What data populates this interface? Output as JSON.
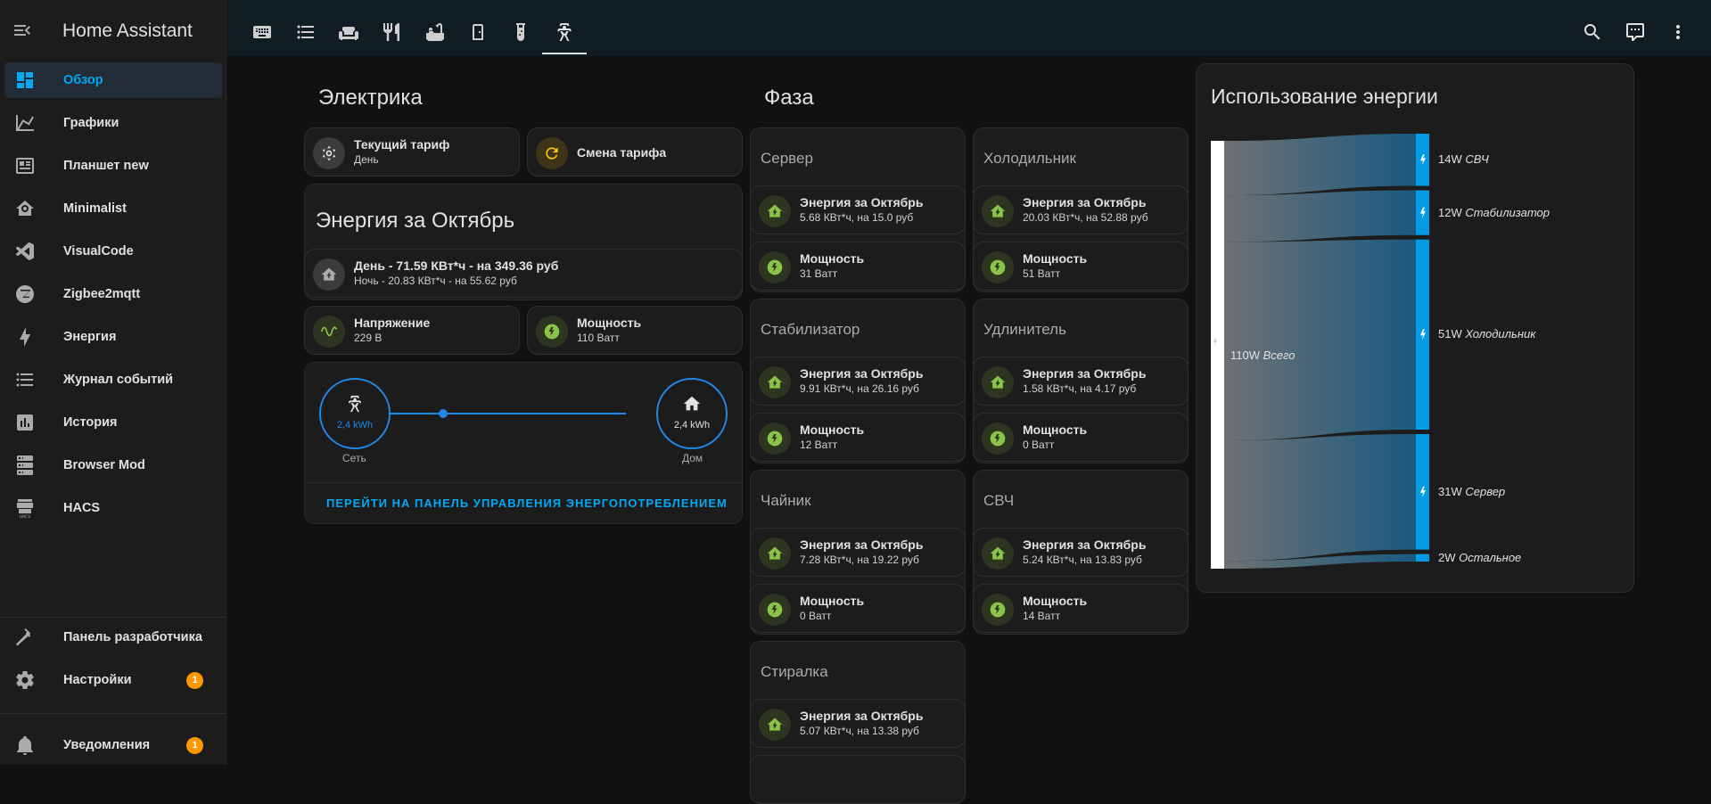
{
  "app": {
    "title": "Home Assistant"
  },
  "sidebar": {
    "items": [
      {
        "label": "Обзор"
      },
      {
        "label": "Графики"
      },
      {
        "label": "Планшет new"
      },
      {
        "label": "Minimalist"
      },
      {
        "label": "VisualCode"
      },
      {
        "label": "Zigbee2mqtt"
      },
      {
        "label": "Энергия"
      },
      {
        "label": "Журнал событий"
      },
      {
        "label": "История"
      },
      {
        "label": "Browser Mod"
      },
      {
        "label": "HACS"
      }
    ],
    "developer": {
      "label": "Панель разработчика"
    },
    "settings": {
      "label": "Настройки",
      "badge": "1"
    },
    "notifications": {
      "label": "Уведомления",
      "badge": "1"
    }
  },
  "colors": {
    "accent": "#03a9f4",
    "badge": "#ff9800",
    "green": "#8bc34a",
    "flow": "#1e88e5"
  },
  "electrics": {
    "title": "Электрика",
    "tariff": {
      "title": "Текущий тариф",
      "value": "День"
    },
    "change_tariff": {
      "title": "Смена тарифа"
    },
    "energy_month": {
      "title": "Энергия за Октябрь",
      "day": "День - 71.59 КВт*ч - на 349.36 руб",
      "night": "Ночь - 20.83 КВт*ч - на 55.62 руб"
    },
    "voltage": {
      "title": "Напряжение",
      "value": "229 В"
    },
    "power": {
      "title": "Мощность",
      "value": "110 Ватт"
    },
    "flow": {
      "grid_value": "2,4 kWh",
      "grid_label": "Сеть",
      "home_value": "2,4 kWh",
      "home_label": "Дом",
      "link": "ПЕРЕЙТИ НА ПАНЕЛЬ УПРАВЛЕНИЯ ЭНЕРГОПОТРЕБЛЕНИЕМ"
    }
  },
  "phase": {
    "title": "Фаза",
    "energy_label": "Энергия за Октябрь",
    "power_label": "Мощность",
    "devices": [
      {
        "name": "Сервер",
        "energy": "5.68 КВт*ч, на 15.0 руб",
        "power": "31 Ватт"
      },
      {
        "name": "Холодильник",
        "energy": "20.03 КВт*ч, на 52.88 руб",
        "power": "51 Ватт"
      },
      {
        "name": "Стабилизатор",
        "energy": "9.91 КВт*ч, на 26.16 руб",
        "power": "12 Ватт"
      },
      {
        "name": "Удлинитель",
        "energy": "1.58 КВт*ч, на 4.17 руб",
        "power": "0 Ватт"
      },
      {
        "name": "Чайник",
        "energy": "7.28 КВт*ч, на 19.22 руб",
        "power": "0 Ватт"
      },
      {
        "name": "СВЧ",
        "energy": "5.24 КВт*ч, на 13.83 руб",
        "power": "14 Ватт"
      },
      {
        "name": "Стиралка",
        "energy": "5.07 КВт*ч, на 13.38 руб",
        "power": ""
      }
    ]
  },
  "energy_usage": {
    "title": "Использование энергии",
    "total": {
      "value": "110W",
      "name": "Всего"
    },
    "flows": [
      {
        "value": "14W",
        "name": "СВЧ",
        "watts": 14
      },
      {
        "value": "12W",
        "name": "Стабилизатор",
        "watts": 12
      },
      {
        "value": "51W",
        "name": "Холодильник",
        "watts": 51
      },
      {
        "value": "31W",
        "name": "Сервер",
        "watts": 31
      },
      {
        "value": "2W",
        "name": "Остальное",
        "watts": 2
      }
    ]
  }
}
